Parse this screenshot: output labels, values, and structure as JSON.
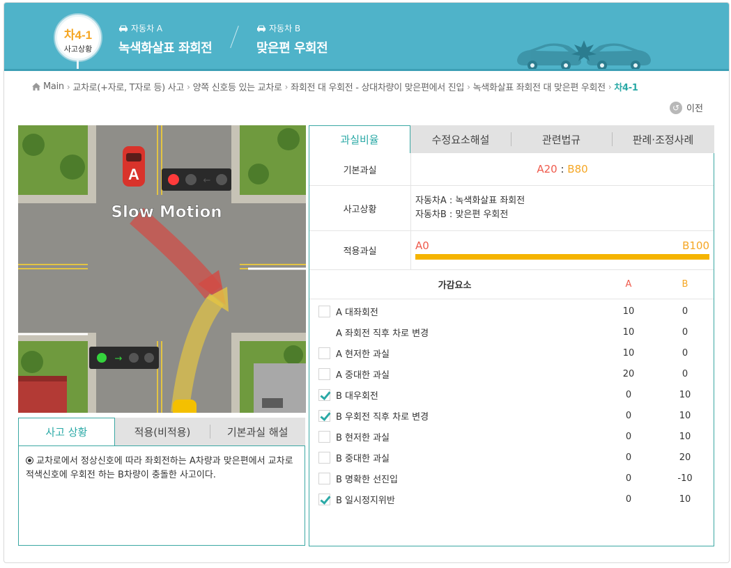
{
  "header": {
    "code": "차4-1",
    "code_sub": "사고상황",
    "vehicle_a_label": "자동차 A",
    "vehicle_a_value": "녹색화살표 좌회전",
    "vehicle_b_label": "자동차 B",
    "vehicle_b_value": "맞은편 우회전"
  },
  "breadcrumb": [
    "Main",
    "교차로(+자로, T자로 등) 사고",
    "양쪽 신호등 있는 교차로",
    "좌회전 대 우회전 - 상대차량이 맞은편에서 진입",
    "녹색화살표 좌회전 대 맞은편 우회전",
    "차4-1"
  ],
  "prev_label": "이전",
  "scene": {
    "car_a_label": "A",
    "slow_motion": "Slow Motion"
  },
  "left_tabs": [
    "사고 상황",
    "적용(비적용)",
    "기본과실 해설"
  ],
  "left_content": "교차로에서 정상신호에 따라 좌회전하는 A차량과 맞은편에서 교차로 적색신호에 우회전 하는 B차량이 충돌한 사고이다.",
  "right_tabs": [
    "과실비율",
    "수정요소해설",
    "관련법규",
    "판례·조정사례"
  ],
  "basic_fault": {
    "label": "기본과실",
    "a": "A20",
    "sep": " : ",
    "b": "B80"
  },
  "situation": {
    "label": "사고상황",
    "line1": "자동차A : 녹색화살표 좌회전",
    "line2": "자동차B : 맞은편 우회전"
  },
  "applied_fault": {
    "label": "적용과실",
    "a": "A0",
    "b": "B100",
    "b_share": 1.0
  },
  "factors_header": {
    "name": "가감요소",
    "a": "A",
    "b": "B"
  },
  "factors": [
    {
      "name": "A 대좌회전",
      "a": "10",
      "b": "0",
      "checked": false,
      "checkbox": true
    },
    {
      "name": "A 좌회전 직후 차로 변경",
      "a": "10",
      "b": "0",
      "checked": false,
      "checkbox": false
    },
    {
      "name": "A 현저한 과실",
      "a": "10",
      "b": "0",
      "checked": false,
      "checkbox": true
    },
    {
      "name": "A 중대한 과실",
      "a": "20",
      "b": "0",
      "checked": false,
      "checkbox": true
    },
    {
      "name": "B 대우회전",
      "a": "0",
      "b": "10",
      "checked": true,
      "checkbox": true
    },
    {
      "name": "B 우회전 직후 차로 변경",
      "a": "0",
      "b": "10",
      "checked": true,
      "checkbox": true
    },
    {
      "name": "B 현저한 과실",
      "a": "0",
      "b": "10",
      "checked": false,
      "checkbox": true
    },
    {
      "name": "B 중대한 과실",
      "a": "0",
      "b": "20",
      "checked": false,
      "checkbox": true
    },
    {
      "name": "B 명확한 선진입",
      "a": "0",
      "b": "-10",
      "checked": false,
      "checkbox": true
    },
    {
      "name": "B 일시정지위반",
      "a": "0",
      "b": "10",
      "checked": true,
      "checkbox": true
    }
  ],
  "colors": {
    "header_bg": "#4fb3c9",
    "accent": "#2aa9a6",
    "a_color": "#ef5a4c",
    "b_color": "#f5a623"
  }
}
